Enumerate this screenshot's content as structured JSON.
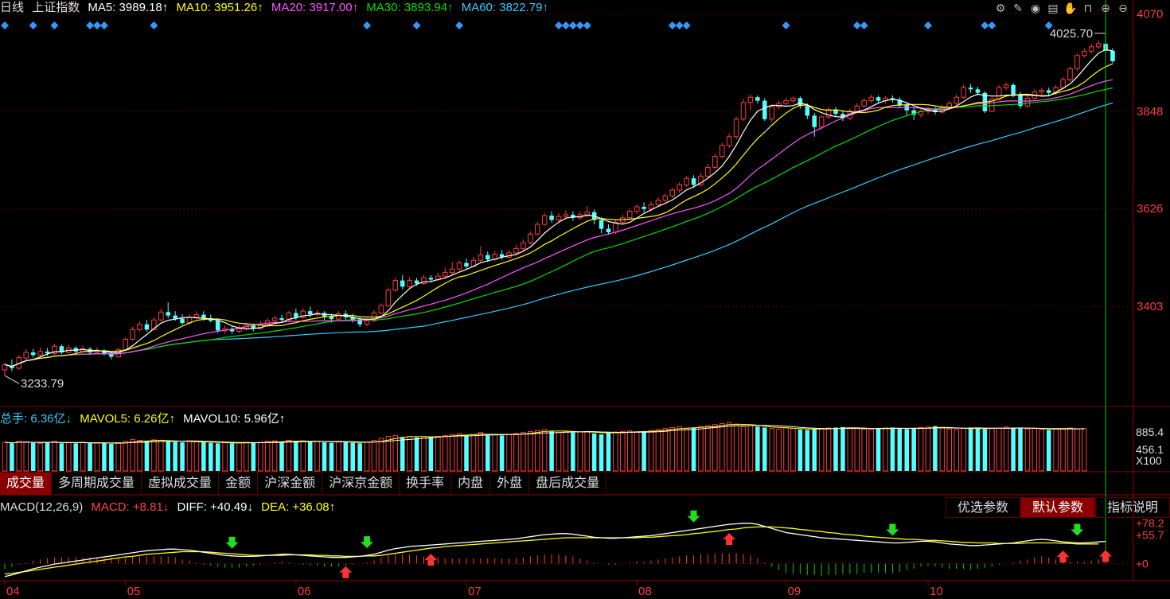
{
  "header": {
    "period": "日线",
    "index_name": "上证指数",
    "ma_items": [
      {
        "label": "MA5: 3989.18↑",
        "color": "#ffffff"
      },
      {
        "label": "MA10: 3951.26↑",
        "color": "#ffff00"
      },
      {
        "label": "MA20: 3917.00↑",
        "color": "#ff55ff"
      },
      {
        "label": "MA30: 3893.94↑",
        "color": "#00dd00"
      },
      {
        "label": "MA60: 3822.79↑",
        "color": "#33ccff"
      }
    ]
  },
  "toolbar_icons": [
    "gear-icon",
    "pen-icon",
    "eye-icon",
    "briefcase-icon",
    "hand-icon",
    "lock-icon",
    "zoom-in-icon",
    "zoom-out-icon"
  ],
  "volume_legend": {
    "items": [
      {
        "label": "总手: 6.36亿↓",
        "color": "#33ccff"
      },
      {
        "label": "MAVOL5: 6.26亿↑",
        "color": "#ffff00"
      },
      {
        "label": "MAVOL10: 5.96亿↑",
        "color": "#ffffff"
      }
    ]
  },
  "indicator_tabs": [
    "成交量",
    "多周期成交量",
    "虚拟成交量",
    "金额",
    "沪深金额",
    "沪深京金额",
    "换手率",
    "内盘",
    "外盘",
    "盘后成交量"
  ],
  "macd_legend": {
    "items": [
      {
        "label": "MACD(12,26,9)",
        "color": "#dddddd"
      },
      {
        "label": "MACD: +8.81↓",
        "color": "#ff4444"
      },
      {
        "label": "DIFF: +40.49↓",
        "color": "#ffffff"
      },
      {
        "label": "DEA: +36.08↑",
        "color": "#ffff00"
      }
    ]
  },
  "param_buttons": [
    "优选参数",
    "默认参数",
    "指标说明"
  ],
  "chart_data": {
    "type": "candlestick",
    "x_ticks": [
      "04",
      "05",
      "06",
      "07",
      "08",
      "09",
      "10"
    ],
    "price_axis_ticks": [
      "4070",
      "3848",
      "3626",
      "3403"
    ],
    "price_ylim": [
      3180,
      4080
    ],
    "high_marker": "4025.70",
    "low_marker": "3233.79",
    "candles": [
      [
        3258,
        3270,
        3245,
        3275
      ],
      [
        3268,
        3262,
        3255,
        3282
      ],
      [
        3262,
        3286,
        3258,
        3292
      ],
      [
        3285,
        3298,
        3280,
        3305
      ],
      [
        3298,
        3292,
        3286,
        3306
      ],
      [
        3292,
        3300,
        3288,
        3310
      ],
      [
        3300,
        3296,
        3290,
        3308
      ],
      [
        3296,
        3312,
        3292,
        3318
      ],
      [
        3312,
        3298,
        3294,
        3316
      ],
      [
        3298,
        3308,
        3296,
        3315
      ],
      [
        3308,
        3300,
        3294,
        3312
      ],
      [
        3300,
        3306,
        3298,
        3314
      ],
      [
        3306,
        3298,
        3292,
        3310
      ],
      [
        3298,
        3302,
        3296,
        3310
      ],
      [
        3302,
        3295,
        3290,
        3306
      ],
      [
        3295,
        3288,
        3282,
        3300
      ],
      [
        3288,
        3304,
        3286,
        3308
      ],
      [
        3304,
        3328,
        3302,
        3332
      ],
      [
        3328,
        3350,
        3325,
        3356
      ],
      [
        3350,
        3362,
        3346,
        3368
      ],
      [
        3362,
        3350,
        3345,
        3372
      ],
      [
        3350,
        3372,
        3348,
        3378
      ],
      [
        3372,
        3390,
        3368,
        3398
      ],
      [
        3390,
        3382,
        3376,
        3412
      ],
      [
        3382,
        3375,
        3370,
        3392
      ],
      [
        3375,
        3365,
        3360,
        3385
      ],
      [
        3365,
        3378,
        3360,
        3385
      ],
      [
        3378,
        3384,
        3374,
        3392
      ],
      [
        3384,
        3376,
        3370,
        3392
      ],
      [
        3376,
        3370,
        3366,
        3384
      ],
      [
        3370,
        3348,
        3342,
        3376
      ],
      [
        3348,
        3352,
        3340,
        3360
      ],
      [
        3352,
        3346,
        3340,
        3358
      ],
      [
        3346,
        3352,
        3342,
        3360
      ],
      [
        3352,
        3360,
        3348,
        3366
      ],
      [
        3360,
        3352,
        3346,
        3364
      ],
      [
        3352,
        3362,
        3350,
        3370
      ],
      [
        3362,
        3370,
        3356,
        3376
      ],
      [
        3370,
        3376,
        3366,
        3382
      ],
      [
        3376,
        3372,
        3366,
        3384
      ],
      [
        3372,
        3388,
        3370,
        3392
      ],
      [
        3388,
        3378,
        3372,
        3398
      ],
      [
        3378,
        3392,
        3374,
        3398
      ],
      [
        3392,
        3385,
        3378,
        3402
      ],
      [
        3385,
        3388,
        3380,
        3395
      ],
      [
        3388,
        3380,
        3372,
        3392
      ],
      [
        3380,
        3374,
        3366,
        3386
      ],
      [
        3374,
        3386,
        3370,
        3392
      ],
      [
        3386,
        3378,
        3372,
        3394
      ],
      [
        3378,
        3372,
        3366,
        3386
      ],
      [
        3372,
        3362,
        3356,
        3378
      ],
      [
        3362,
        3370,
        3358,
        3376
      ],
      [
        3370,
        3388,
        3368,
        3394
      ],
      [
        3388,
        3405,
        3386,
        3410
      ],
      [
        3405,
        3440,
        3402,
        3446
      ],
      [
        3440,
        3462,
        3436,
        3468
      ],
      [
        3462,
        3448,
        3442,
        3474
      ],
      [
        3448,
        3462,
        3444,
        3470
      ],
      [
        3462,
        3455,
        3450,
        3468
      ],
      [
        3455,
        3468,
        3452,
        3474
      ],
      [
        3468,
        3464,
        3458,
        3474
      ],
      [
        3464,
        3472,
        3460,
        3480
      ],
      [
        3472,
        3480,
        3468,
        3492
      ],
      [
        3480,
        3488,
        3474,
        3504
      ],
      [
        3488,
        3502,
        3484,
        3508
      ],
      [
        3502,
        3494,
        3488,
        3512
      ],
      [
        3494,
        3508,
        3492,
        3516
      ],
      [
        3508,
        3520,
        3504,
        3540
      ],
      [
        3520,
        3510,
        3504,
        3528
      ],
      [
        3510,
        3522,
        3506,
        3530
      ],
      [
        3522,
        3515,
        3510,
        3532
      ],
      [
        3515,
        3525,
        3512,
        3532
      ],
      [
        3525,
        3535,
        3520,
        3544
      ],
      [
        3535,
        3548,
        3530,
        3556
      ],
      [
        3548,
        3568,
        3544,
        3574
      ],
      [
        3568,
        3590,
        3564,
        3596
      ],
      [
        3590,
        3610,
        3586,
        3616
      ],
      [
        3610,
        3600,
        3594,
        3620
      ],
      [
        3600,
        3608,
        3596,
        3616
      ],
      [
        3608,
        3612,
        3602,
        3622
      ],
      [
        3612,
        3605,
        3598,
        3620
      ],
      [
        3605,
        3612,
        3600,
        3620
      ],
      [
        3612,
        3618,
        3606,
        3632
      ],
      [
        3618,
        3600,
        3590,
        3624
      ],
      [
        3600,
        3580,
        3570,
        3606
      ],
      [
        3580,
        3572,
        3566,
        3590
      ],
      [
        3572,
        3595,
        3568,
        3600
      ],
      [
        3595,
        3605,
        3590,
        3612
      ],
      [
        3605,
        3620,
        3600,
        3626
      ],
      [
        3620,
        3630,
        3614,
        3636
      ],
      [
        3630,
        3625,
        3618,
        3640
      ],
      [
        3625,
        3635,
        3620,
        3642
      ],
      [
        3635,
        3645,
        3630,
        3652
      ],
      [
        3645,
        3655,
        3640,
        3662
      ],
      [
        3655,
        3668,
        3650,
        3674
      ],
      [
        3668,
        3680,
        3662,
        3686
      ],
      [
        3680,
        3695,
        3676,
        3700
      ],
      [
        3695,
        3680,
        3674,
        3702
      ],
      [
        3680,
        3700,
        3676,
        3708
      ],
      [
        3700,
        3720,
        3696,
        3728
      ],
      [
        3720,
        3745,
        3716,
        3752
      ],
      [
        3745,
        3770,
        3740,
        3776
      ],
      [
        3770,
        3790,
        3764,
        3798
      ],
      [
        3790,
        3830,
        3784,
        3836
      ],
      [
        3830,
        3868,
        3826,
        3876
      ],
      [
        3868,
        3880,
        3850,
        3886
      ],
      [
        3880,
        3872,
        3866,
        3884
      ],
      [
        3872,
        3830,
        3826,
        3878
      ],
      [
        3830,
        3858,
        3824,
        3862
      ],
      [
        3858,
        3866,
        3852,
        3872
      ],
      [
        3866,
        3872,
        3860,
        3878
      ],
      [
        3872,
        3878,
        3866,
        3882
      ],
      [
        3878,
        3860,
        3854,
        3882
      ],
      [
        3860,
        3838,
        3830,
        3866
      ],
      [
        3838,
        3812,
        3790,
        3844
      ],
      [
        3812,
        3835,
        3806,
        3840
      ],
      [
        3835,
        3852,
        3830,
        3858
      ],
      [
        3852,
        3842,
        3836,
        3858
      ],
      [
        3842,
        3832,
        3826,
        3850
      ],
      [
        3832,
        3848,
        3828,
        3854
      ],
      [
        3848,
        3860,
        3844,
        3866
      ],
      [
        3860,
        3872,
        3856,
        3878
      ],
      [
        3872,
        3880,
        3866,
        3886
      ],
      [
        3880,
        3872,
        3866,
        3884
      ],
      [
        3872,
        3878,
        3866,
        3882
      ],
      [
        3878,
        3874,
        3868,
        3884
      ],
      [
        3874,
        3862,
        3856,
        3880
      ],
      [
        3862,
        3850,
        3836,
        3868
      ],
      [
        3850,
        3840,
        3828,
        3856
      ],
      [
        3840,
        3848,
        3834,
        3854
      ],
      [
        3848,
        3852,
        3842,
        3858
      ],
      [
        3852,
        3846,
        3840,
        3858
      ],
      [
        3846,
        3856,
        3842,
        3862
      ],
      [
        3856,
        3866,
        3850,
        3872
      ],
      [
        3866,
        3880,
        3860,
        3886
      ],
      [
        3880,
        3902,
        3876,
        3908
      ],
      [
        3902,
        3898,
        3890,
        3910
      ],
      [
        3898,
        3890,
        3884,
        3904
      ],
      [
        3890,
        3848,
        3844,
        3894
      ],
      [
        3848,
        3876,
        3846,
        3882
      ],
      [
        3876,
        3902,
        3872,
        3908
      ],
      [
        3902,
        3908,
        3896,
        3914
      ],
      [
        3908,
        3886,
        3880,
        3912
      ],
      [
        3886,
        3860,
        3854,
        3892
      ],
      [
        3860,
        3878,
        3856,
        3884
      ],
      [
        3878,
        3892,
        3874,
        3898
      ],
      [
        3892,
        3896,
        3886,
        3902
      ],
      [
        3896,
        3890,
        3884,
        3902
      ],
      [
        3890,
        3902,
        3886,
        3908
      ],
      [
        3902,
        3920,
        3898,
        3926
      ],
      [
        3920,
        3945,
        3916,
        3950
      ],
      [
        3945,
        3975,
        3940,
        3980
      ],
      [
        3975,
        3985,
        3970,
        3992
      ],
      [
        3985,
        3995,
        3980,
        4002
      ],
      [
        3995,
        4002,
        3990,
        4010
      ],
      [
        4002,
        3986,
        3980,
        4025.7
      ],
      [
        3986,
        3962,
        3958,
        3992
      ]
    ],
    "volume_axis_ticks": [
      "885.4",
      "456.1",
      "X100"
    ],
    "volume_ylim": [
      0,
      1000
    ],
    "volume": [
      580,
      560,
      600,
      590,
      570,
      560,
      580,
      600,
      560,
      570,
      560,
      580,
      560,
      570,
      560,
      550,
      570,
      600,
      640,
      620,
      600,
      630,
      620,
      600,
      590,
      580,
      600,
      590,
      580,
      570,
      560,
      570,
      560,
      570,
      580,
      570,
      580,
      600,
      610,
      590,
      620,
      600,
      610,
      590,
      600,
      580,
      570,
      600,
      590,
      570,
      560,
      580,
      620,
      660,
      700,
      720,
      690,
      700,
      680,
      700,
      690,
      700,
      720,
      740,
      760,
      720,
      740,
      780,
      720,
      740,
      720,
      740,
      760,
      780,
      800,
      820,
      840,
      800,
      780,
      800,
      780,
      790,
      800,
      760,
      740,
      780,
      790,
      800,
      810,
      790,
      800,
      820,
      840,
      860,
      880,
      900,
      860,
      880,
      900,
      920,
      940,
      960,
      980,
      940,
      900,
      920,
      900,
      880,
      860,
      850,
      880,
      860,
      840,
      830,
      850,
      860,
      870,
      880,
      890,
      870,
      860,
      850,
      840,
      860,
      870,
      880,
      860,
      850,
      870,
      880,
      890,
      910,
      870,
      850,
      840,
      860,
      880,
      870,
      850,
      860,
      870,
      890,
      880,
      860,
      850,
      860,
      840,
      830,
      850,
      860,
      870,
      850,
      860
    ],
    "macd_axis_ticks": [
      "+78.2",
      "+55.7",
      "+0"
    ],
    "macd_ylim": [
      -30,
      90
    ],
    "diff": [
      -25,
      -22,
      -18,
      -14,
      -10,
      -7,
      -4,
      -1,
      1,
      3,
      5,
      7,
      9,
      11,
      13,
      15,
      17,
      19,
      21,
      23,
      25,
      26,
      27,
      28,
      28,
      27,
      26,
      24,
      22,
      20,
      18,
      16,
      15,
      14,
      14,
      14,
      15,
      16,
      17,
      18,
      18,
      17,
      16,
      15,
      14,
      13,
      12,
      12,
      12,
      13,
      14,
      16,
      18,
      22,
      26,
      29,
      31,
      33,
      34,
      35,
      36,
      37,
      38,
      39,
      40,
      41,
      42,
      43,
      44,
      45,
      46,
      47,
      48,
      50,
      52,
      54,
      56,
      57,
      58,
      58,
      57,
      55,
      53,
      51,
      50,
      49,
      49,
      50,
      51,
      52,
      53,
      54,
      56,
      58,
      60,
      62,
      64,
      66,
      68,
      70,
      72,
      74,
      76,
      77,
      78,
      78,
      76,
      72,
      68,
      64,
      60,
      58,
      56,
      54,
      52,
      50,
      49,
      48,
      47,
      46,
      45,
      44,
      43,
      42,
      41,
      40,
      40,
      41,
      42,
      43,
      43,
      42,
      40,
      38,
      37,
      36,
      35,
      35,
      36,
      37,
      38,
      39,
      40,
      42,
      44,
      46,
      47,
      46,
      44,
      42,
      41,
      40,
      40,
      41,
      42,
      43
    ],
    "dea": [
      -20,
      -19,
      -17,
      -15,
      -13,
      -11,
      -9,
      -7,
      -5,
      -3,
      -1,
      1,
      3,
      5,
      7,
      9,
      11,
      13,
      14,
      16,
      18,
      19,
      20,
      21,
      22,
      23,
      23,
      23,
      23,
      22,
      21,
      20,
      19,
      18,
      17,
      16,
      16,
      16,
      16,
      16,
      17,
      17,
      17,
      17,
      16,
      16,
      15,
      15,
      14,
      14,
      14,
      15,
      15,
      16,
      18,
      20,
      22,
      24,
      26,
      28,
      30,
      31,
      33,
      34,
      35,
      36,
      37,
      38,
      39,
      40,
      41,
      42,
      43,
      44,
      45,
      46,
      47,
      48,
      49,
      50,
      50,
      50,
      50,
      50,
      50,
      50,
      50,
      50,
      50,
      50,
      51,
      51,
      52,
      53,
      54,
      55,
      56,
      58,
      59,
      61,
      62,
      64,
      66,
      67,
      69,
      70,
      71,
      71,
      71,
      70,
      69,
      68,
      66,
      65,
      63,
      62,
      60,
      59,
      57,
      56,
      55,
      53,
      52,
      51,
      50,
      49,
      48,
      47,
      47,
      46,
      45,
      45,
      44,
      43,
      42,
      41,
      41,
      40,
      40,
      40,
      39,
      39,
      39,
      39,
      40,
      40,
      40,
      40,
      40,
      39,
      39,
      38,
      38,
      38,
      38
    ]
  }
}
